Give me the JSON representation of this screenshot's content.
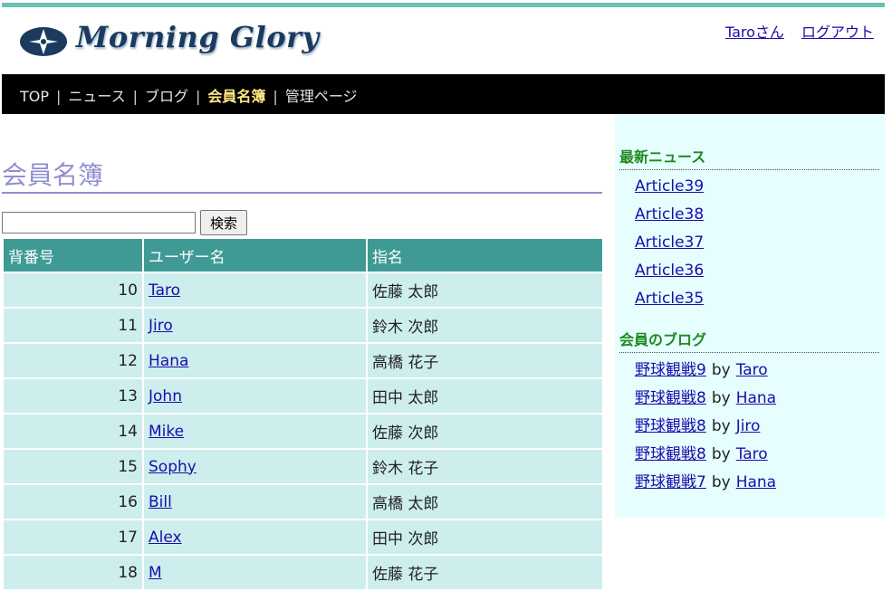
{
  "brand": {
    "name": "Morning Glory"
  },
  "user": {
    "greeting": "Taroさん",
    "logout": "ログアウト"
  },
  "nav": {
    "items": [
      "TOP",
      "ニュース",
      "ブログ",
      "会員名簿",
      "管理ページ"
    ],
    "separator": "|",
    "active_index": 3
  },
  "page": {
    "title": "会員名簿"
  },
  "search": {
    "button_label": "検索",
    "value": ""
  },
  "table": {
    "headers": [
      "背番号",
      "ユーザー名",
      "指名"
    ],
    "rows": [
      [
        "10",
        "Taro",
        "佐藤 太郎"
      ],
      [
        "11",
        "Jiro",
        "鈴木 次郎"
      ],
      [
        "12",
        "Hana",
        "高橋 花子"
      ],
      [
        "13",
        "John",
        "田中 太郎"
      ],
      [
        "14",
        "Mike",
        "佐藤 次郎"
      ],
      [
        "15",
        "Sophy",
        "鈴木 花子"
      ],
      [
        "16",
        "Bill",
        "高橋 太郎"
      ],
      [
        "17",
        "Alex",
        "田中 次郎"
      ],
      [
        "18",
        "M",
        "佐藤 花子"
      ]
    ]
  },
  "sidebar": {
    "news_heading": "最新ニュース",
    "news": [
      "Article39",
      "Article38",
      "Article37",
      "Article36",
      "Article35"
    ],
    "blog_heading": "会員のブログ",
    "by_word": "by",
    "blogs": [
      {
        "title": "野球観戦9",
        "author": "Taro"
      },
      {
        "title": "野球観戦8",
        "author": "Hana"
      },
      {
        "title": "野球観戦8",
        "author": "Jiro"
      },
      {
        "title": "野球観戦8",
        "author": "Taro"
      },
      {
        "title": "野球観戦7",
        "author": "Hana"
      }
    ]
  },
  "colors": {
    "accent_bar": "#6cc0b8",
    "table_header": "#3f9a95",
    "table_cell": "#cdeeed",
    "title": "#8f8fd0",
    "sidebar_bg": "#e6fefe",
    "sidebar_heading": "#1f8a1f",
    "nav_active": "#ffe680"
  }
}
